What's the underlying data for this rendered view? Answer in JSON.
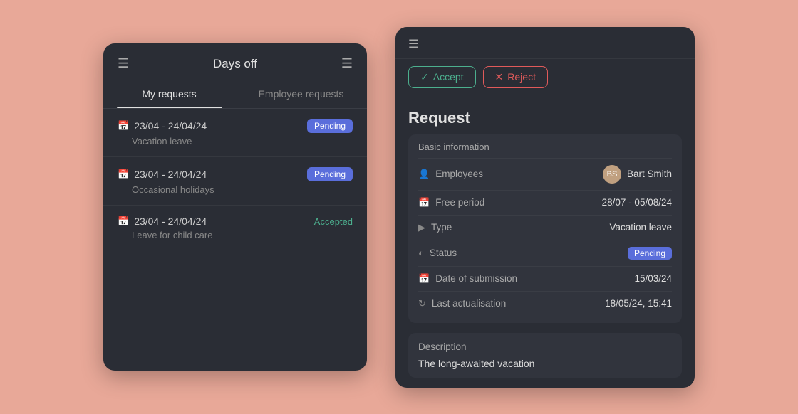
{
  "left_panel": {
    "title": "Days off",
    "tabs": [
      {
        "id": "my-requests",
        "label": "My requests",
        "active": true
      },
      {
        "id": "employee-requests",
        "label": "Employee requests",
        "active": false
      }
    ],
    "requests": [
      {
        "date": "23/04 - 24/04/24",
        "type": "Vacation leave",
        "status": "Pending",
        "status_type": "pending"
      },
      {
        "date": "23/04 - 24/04/24",
        "type": "Occasional holidays",
        "status": "Pending",
        "status_type": "pending"
      },
      {
        "date": "23/04 - 24/04/24",
        "type": "Leave for child care",
        "status": "Accepted",
        "status_type": "accepted"
      }
    ]
  },
  "right_panel": {
    "actions": {
      "accept_label": "Accept",
      "reject_label": "Reject",
      "accept_check": "✓",
      "reject_x": "✕"
    },
    "title": "Request",
    "basic_info_label": "Basic information",
    "fields": [
      {
        "icon": "person",
        "label": "Employees",
        "value": "Bart Smith",
        "has_avatar": true
      },
      {
        "icon": "calendar",
        "label": "Free period",
        "value": "28/07 - 05/08/24",
        "has_avatar": false
      },
      {
        "icon": "type",
        "label": "Type",
        "value": "Vacation leave",
        "has_avatar": false
      },
      {
        "icon": "status",
        "label": "Status",
        "value": "Pending",
        "is_badge": true
      },
      {
        "icon": "calendar",
        "label": "Date of submission",
        "value": "15/03/24",
        "has_avatar": false
      },
      {
        "icon": "refresh",
        "label": "Last actualisation",
        "value": "18/05/24, 15:41",
        "has_avatar": false
      }
    ],
    "description_label": "Description",
    "description": "The long-awaited vacation",
    "employee_name": "Bart Smith"
  }
}
